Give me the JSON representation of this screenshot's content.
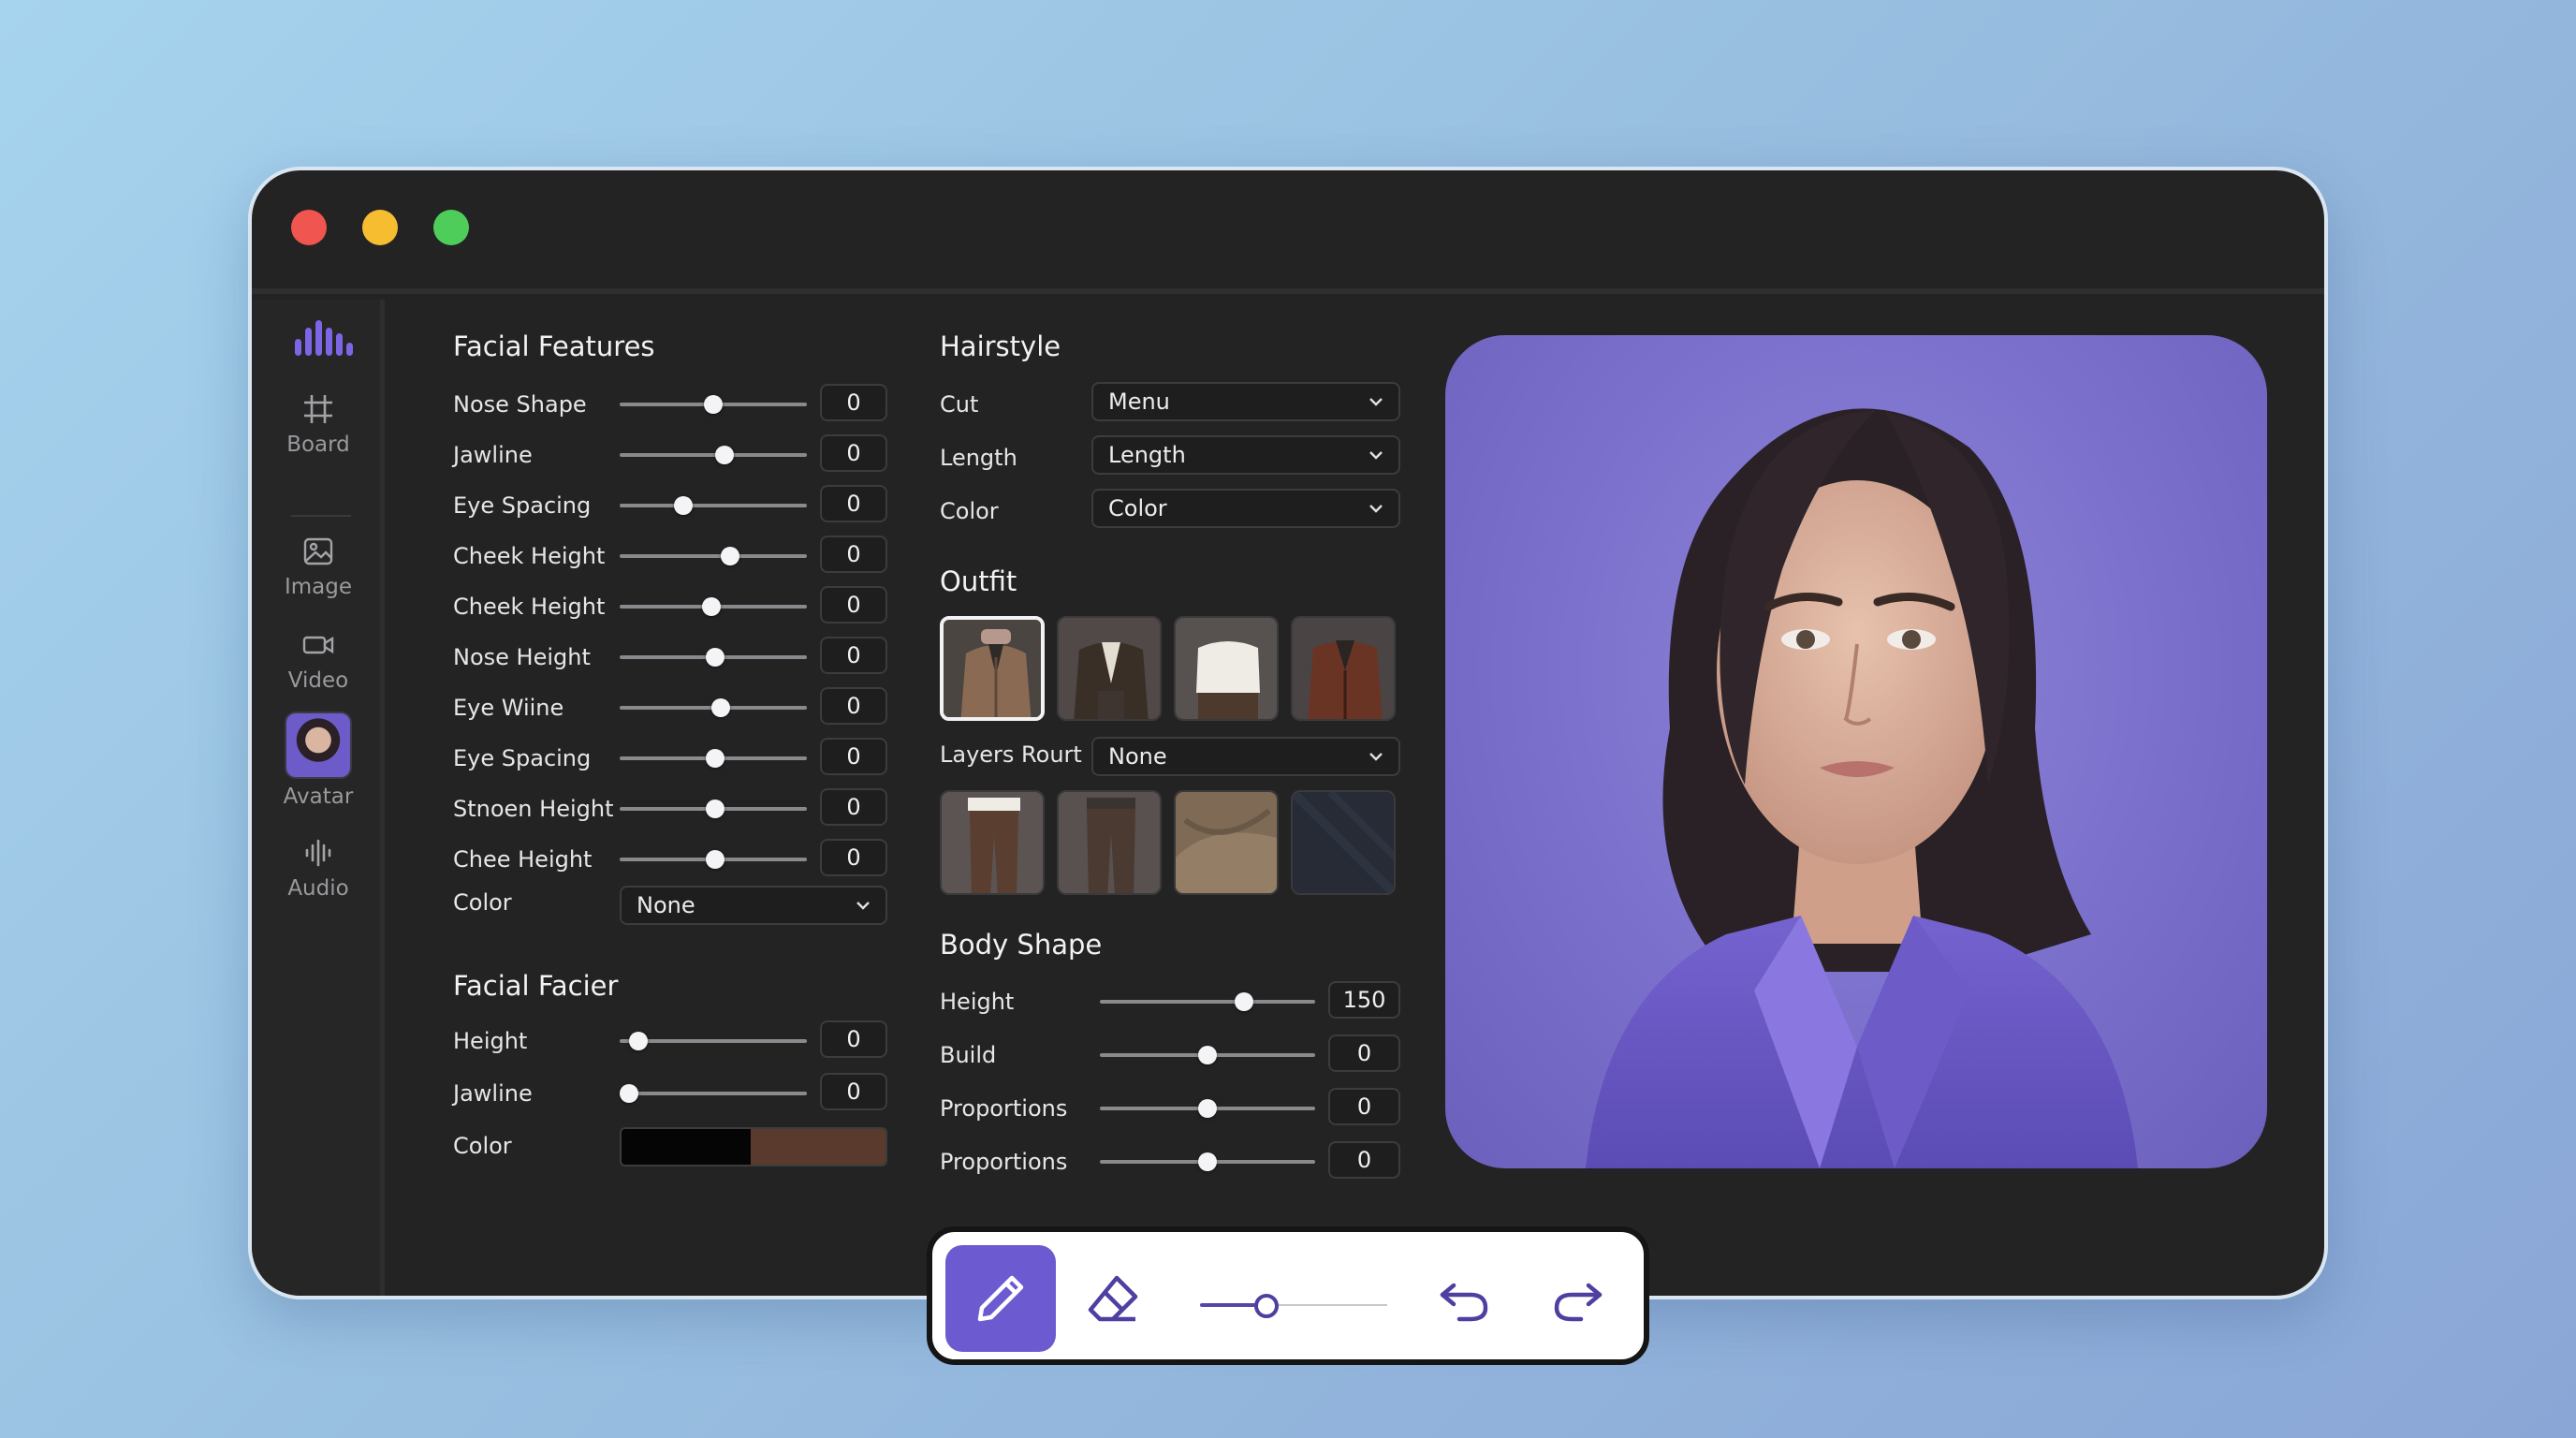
{
  "window": {
    "traffic_lights": [
      "close",
      "minimize",
      "zoom"
    ]
  },
  "rail": {
    "logo": "waveform-logo",
    "items": [
      {
        "label": "Board",
        "icon": "grid-hash-icon"
      },
      {
        "label": "Image",
        "icon": "image-icon"
      },
      {
        "label": "Video",
        "icon": "video-camera-icon"
      },
      {
        "label": "Avatar",
        "icon": "avatar-thumbnail"
      },
      {
        "label": "Audio",
        "icon": "audio-wave-icon"
      }
    ]
  },
  "facial_features": {
    "title": "Facial Features",
    "rows": [
      {
        "label": "Nose Shape",
        "value": "0",
        "level": 0.5
      },
      {
        "label": "Jawline",
        "value": "0",
        "level": 0.56
      },
      {
        "label": "Eye Spacing",
        "value": "0",
        "level": 0.34
      },
      {
        "label": "Cheek Height",
        "value": "0",
        "level": 0.59
      },
      {
        "label": "Cheek Height",
        "value": "0",
        "level": 0.49
      },
      {
        "label": "Nose Height",
        "value": "0",
        "level": 0.51
      },
      {
        "label": "Eye Wiine",
        "value": "0",
        "level": 0.54
      },
      {
        "label": "Eye Spacing",
        "value": "0",
        "level": 0.51
      },
      {
        "label": "Stnoen Height",
        "value": "0",
        "level": 0.51
      },
      {
        "label": "Chee Height",
        "value": "0",
        "level": 0.51
      }
    ],
    "color_label": "Color",
    "color_value": "None"
  },
  "facial_facier": {
    "title": "Facial Facier",
    "rows": [
      {
        "label": "Height",
        "value": "0",
        "level": 0.1
      },
      {
        "label": "Jawline",
        "value": "0",
        "level": 0.05
      }
    ],
    "color_label": "Color",
    "swatches": [
      "#050505",
      "#5a3a2c"
    ]
  },
  "hairstyle": {
    "title": "Hairstyle",
    "rows": [
      {
        "label": "Cut",
        "value": "Menu"
      },
      {
        "label": "Length",
        "value": "Length"
      },
      {
        "label": "Color",
        "value": "Color"
      }
    ]
  },
  "outfit": {
    "title": "Outfit",
    "tops": [
      "camel-coat",
      "brown-blazer",
      "white-blouse",
      "leather-jacket"
    ],
    "layers_label": "Layers Rourt",
    "layers_value": "None",
    "bottoms": [
      "brown-trousers",
      "dark-trousers",
      "beige-fabric",
      "navy-fabric"
    ]
  },
  "body_shape": {
    "title": "Body Shape",
    "rows": [
      {
        "label": "Height",
        "value": "150",
        "level": 0.67
      },
      {
        "label": "Build",
        "value": "0",
        "level": 0.5
      },
      {
        "label": "Proportions",
        "value": "0",
        "level": 0.5
      },
      {
        "label": "Proportions",
        "value": "0",
        "level": 0.5
      }
    ]
  },
  "toolbar": {
    "tools": [
      "pencil-icon",
      "eraser-icon",
      "brush-size-slider",
      "undo-icon",
      "redo-icon"
    ],
    "brush_size_level": 0.29,
    "accent": "#6c5bd0"
  },
  "colors": {
    "window_bg": "#232323",
    "accent": "#7d65e6"
  }
}
